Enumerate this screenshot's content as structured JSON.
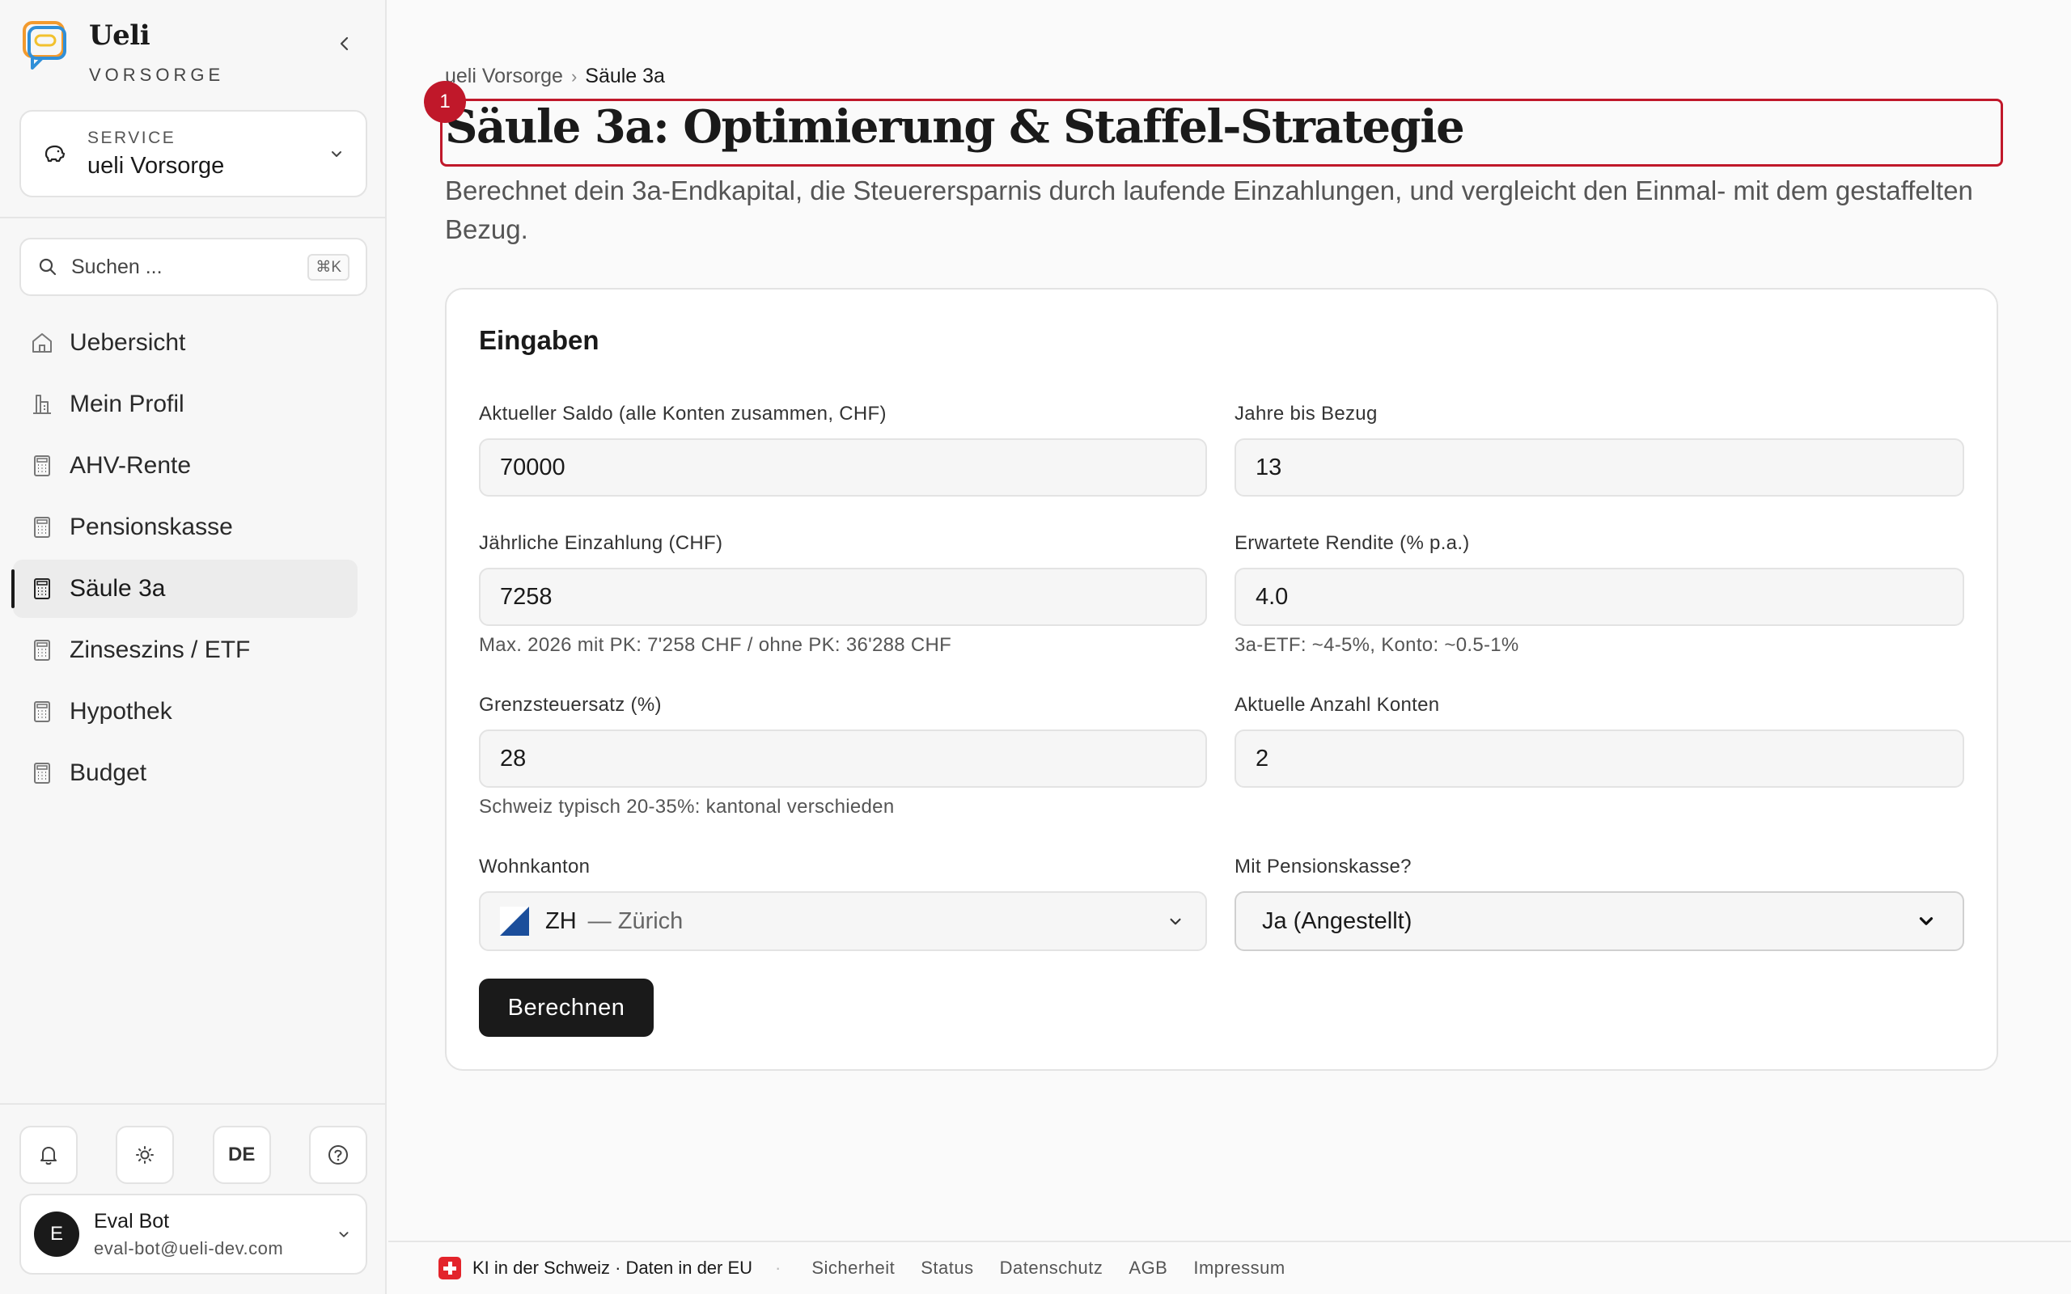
{
  "brand": {
    "name": "Ueli",
    "sub": "VORSORGE"
  },
  "service": {
    "label": "SERVICE",
    "value": "ueli Vorsorge"
  },
  "search": {
    "placeholder": "Suchen ...",
    "shortcut": "⌘K"
  },
  "nav": [
    {
      "label": "Uebersicht",
      "icon": "home-icon"
    },
    {
      "label": "Mein Profil",
      "icon": "bank-icon"
    },
    {
      "label": "AHV-Rente",
      "icon": "calculator-icon"
    },
    {
      "label": "Pensionskasse",
      "icon": "calculator-icon"
    },
    {
      "label": "Säule 3a",
      "icon": "calculator-icon",
      "active": true
    },
    {
      "label": "Zinseszins / ETF",
      "icon": "calculator-icon"
    },
    {
      "label": "Hypothek",
      "icon": "calculator-icon"
    },
    {
      "label": "Budget",
      "icon": "calculator-icon"
    }
  ],
  "tools": {
    "language": "DE"
  },
  "user": {
    "initial": "E",
    "name": "Eval Bot",
    "email": "eval-bot@ueli-dev.com"
  },
  "breadcrumb": {
    "root": "ueli Vorsorge",
    "separator": "›",
    "current": "Säule 3a"
  },
  "marker": "1",
  "page": {
    "title": "Säule 3a: Optimierung & Staffel-Strategie",
    "description": "Berechnet dein 3a-Endkapital, die Steuerersparnis durch laufende Einzahlungen, und vergleicht den Einmal- mit dem gestaffelten Bezug."
  },
  "form": {
    "title": "Eingaben",
    "saldo": {
      "label": "Aktueller Saldo (alle Konten zusammen, CHF)",
      "value": "70000"
    },
    "jahre": {
      "label": "Jahre bis Bezug",
      "value": "13"
    },
    "einzahlung": {
      "label": "Jährliche Einzahlung (CHF)",
      "value": "7258",
      "hint": "Max. 2026 mit PK: 7'258 CHF / ohne PK: 36'288 CHF"
    },
    "rendite": {
      "label": "Erwartete Rendite (% p.a.)",
      "value": "4.0",
      "hint": "3a-ETF: ~4-5%, Konto: ~0.5-1%"
    },
    "steuersatz": {
      "label": "Grenzsteuersatz (%)",
      "value": "28",
      "hint": "Schweiz typisch 20-35%: kantonal verschieden"
    },
    "konten": {
      "label": "Aktuelle Anzahl Konten",
      "value": "2"
    },
    "kanton": {
      "label": "Wohnkanton",
      "code": "ZH",
      "name": "— Zürich"
    },
    "pk": {
      "label": "Mit Pensionskasse?",
      "value": "Ja (Angestellt)"
    },
    "submit": "Berechnen"
  },
  "footer": {
    "main": "KI in der Schweiz · Daten in der EU",
    "dot": "·",
    "links": [
      "Sicherheit",
      "Status",
      "Datenschutz",
      "AGB",
      "Impressum"
    ]
  },
  "colors": {
    "accent": "#c0182a",
    "primary": "#1a1a1a",
    "swiss": "#e3242b"
  }
}
